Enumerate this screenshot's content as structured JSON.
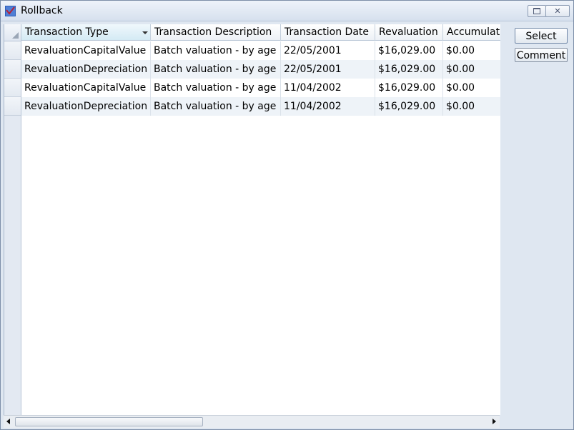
{
  "window": {
    "title": "Rollback"
  },
  "grid": {
    "columns": [
      "Transaction Type",
      "Transaction Description",
      "Transaction Date",
      "Revaluation",
      "Accumulat"
    ],
    "rows": [
      [
        "RevaluationCapitalValue",
        "Batch valuation - by age",
        "22/05/2001",
        "$16,029.00",
        "$0.00"
      ],
      [
        "RevaluationDepreciation",
        "Batch valuation - by age",
        "22/05/2001",
        "$16,029.00",
        "$0.00"
      ],
      [
        "RevaluationCapitalValue",
        "Batch valuation - by age",
        "11/04/2002",
        "$16,029.00",
        "$0.00"
      ],
      [
        "RevaluationDepreciation",
        "Batch valuation - by age",
        "11/04/2002",
        "$16,029.00",
        "$0.00"
      ]
    ]
  },
  "actions": {
    "select_label": "Select",
    "comment_label": "Comment"
  },
  "icons": {
    "app": "rollback-app-icon",
    "maximize": "maximize-icon",
    "close": "close-icon"
  }
}
